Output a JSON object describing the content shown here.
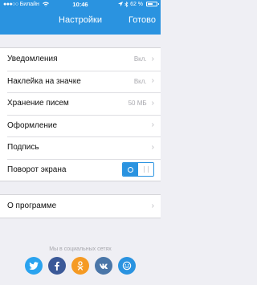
{
  "status_bar": {
    "carrier": "Билайн",
    "time": "10:46",
    "battery": "62 %",
    "battery_level": 0.62
  },
  "nav": {
    "title": "Настройки",
    "done_label": "Готово"
  },
  "settings": [
    {
      "label": "Уведомления",
      "value": "Вкл."
    },
    {
      "label": "Наклейка на значке",
      "value": "Вкл."
    },
    {
      "label": "Хранение писем",
      "value": "50 МБ"
    },
    {
      "label": "Оформление",
      "value": ""
    },
    {
      "label": "Подпись",
      "value": ""
    },
    {
      "label": "Поворот экрана",
      "toggle": true
    }
  ],
  "about": {
    "label": "О программе"
  },
  "social": {
    "caption": "Мы в социальных сетях",
    "icons": [
      "twitter-icon",
      "facebook-icon",
      "odnoklassniki-icon",
      "vk-icon",
      "smiley-icon"
    ],
    "colors": {
      "twitter": "#2aa3ef",
      "facebook": "#3b5998",
      "odnoklassniki": "#f59a23",
      "vk": "#4a76a8",
      "smiley": "#2a93e0"
    }
  },
  "colors": {
    "accent": "#2a93e0",
    "background": "#efeff4"
  }
}
